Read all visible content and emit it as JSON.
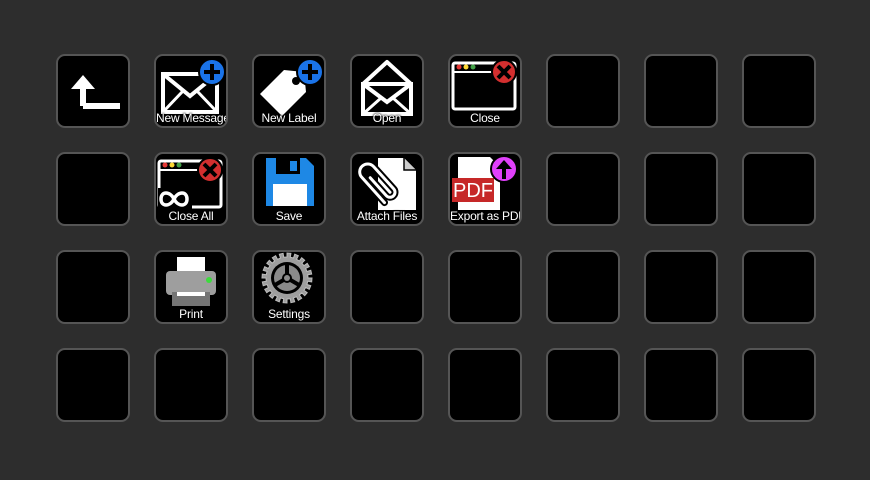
{
  "deck": {
    "rows": 4,
    "columns": 8,
    "keys": [
      {
        "row": 0,
        "col": 0,
        "icon": "back-arrow-icon",
        "label": ""
      },
      {
        "row": 0,
        "col": 1,
        "icon": "new-message-icon",
        "label": "New Message"
      },
      {
        "row": 0,
        "col": 2,
        "icon": "new-label-icon",
        "label": "New Label"
      },
      {
        "row": 0,
        "col": 3,
        "icon": "open-envelope-icon",
        "label": "Open"
      },
      {
        "row": 0,
        "col": 4,
        "icon": "close-window-icon",
        "label": "Close"
      },
      {
        "row": 1,
        "col": 1,
        "icon": "close-all-windows-icon",
        "label": "Close All"
      },
      {
        "row": 1,
        "col": 2,
        "icon": "floppy-disk-icon",
        "label": "Save"
      },
      {
        "row": 1,
        "col": 3,
        "icon": "paperclip-icon",
        "label": "Attach Files"
      },
      {
        "row": 1,
        "col": 4,
        "icon": "pdf-export-icon",
        "label": "Export as PDF"
      },
      {
        "row": 2,
        "col": 1,
        "icon": "printer-icon",
        "label": "Print"
      },
      {
        "row": 2,
        "col": 2,
        "icon": "gear-icon",
        "label": "Settings"
      }
    ]
  },
  "icon_text": {
    "pdf": "PDF"
  },
  "colors": {
    "background": "#2d2d2d",
    "key_fill": "#000000",
    "key_border": "#555555",
    "plus_badge": "#1a73e8",
    "close_badge": "#d32f2f",
    "upload_badge": "#e040fb",
    "pdf_red": "#c62828",
    "floppy_blue": "#1e88e5"
  }
}
